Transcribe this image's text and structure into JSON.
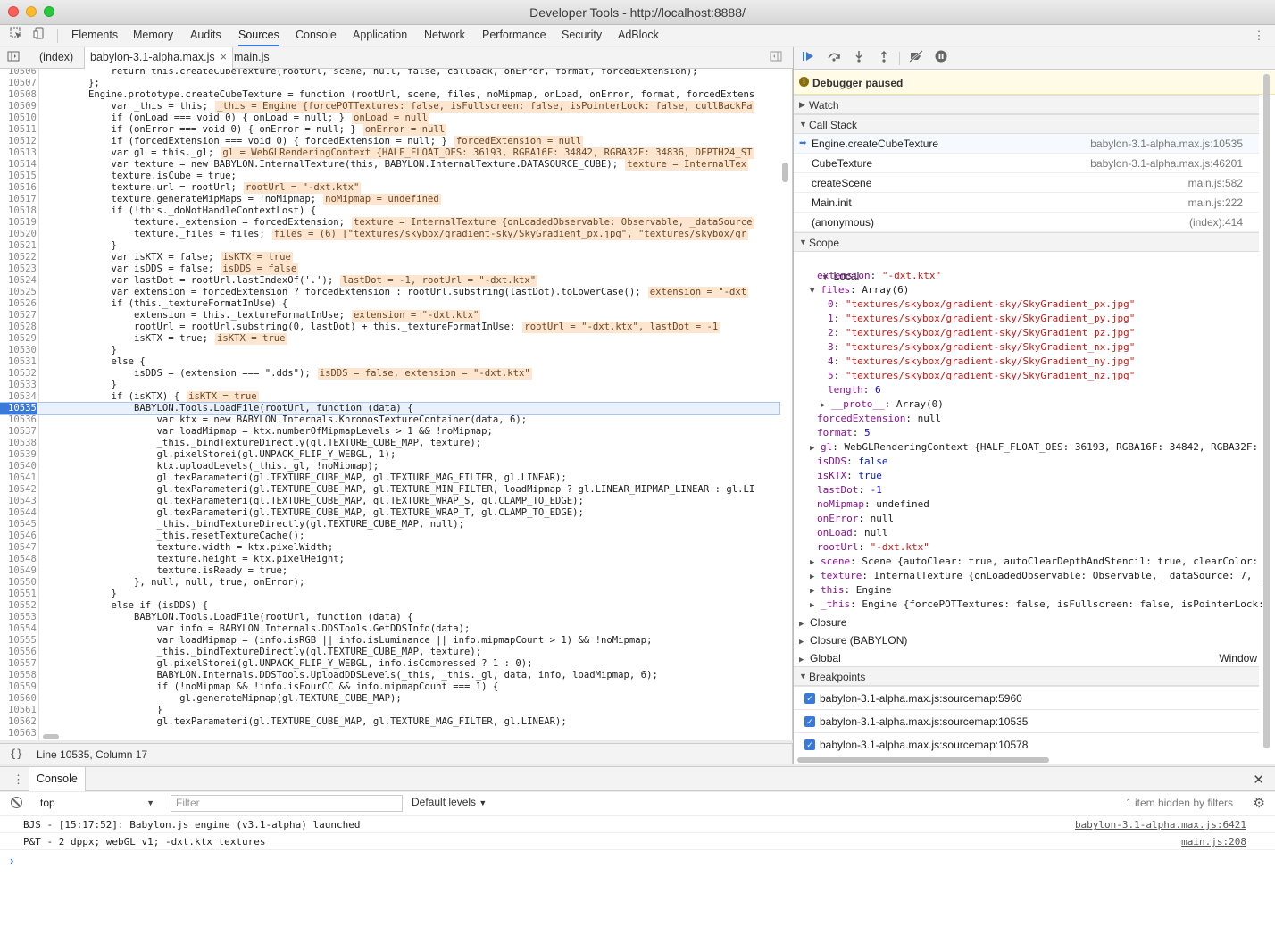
{
  "window": {
    "title": "Developer Tools - http://localhost:8888/"
  },
  "main_tabs": [
    "Elements",
    "Memory",
    "Audits",
    "Sources",
    "Console",
    "Application",
    "Network",
    "Performance",
    "Security",
    "AdBlock"
  ],
  "active_main_tab": "Sources",
  "file_tabs": [
    {
      "label": "(index)"
    },
    {
      "label": "babylon-3.1-alpha.max.js",
      "close": "×"
    },
    {
      "label": "main.js"
    }
  ],
  "code_lines": [
    [
      "10506",
      "            return this.createCubeTexture(rootUrl, scene, null, false, callback, onError, format, forcedExtension);",
      ""
    ],
    [
      "10507",
      "        };",
      ""
    ],
    [
      "10508",
      "        Engine.prototype.createCubeTexture = function (rootUrl, scene, files, noMipmap, onLoad, onError, format, forcedExtens",
      ""
    ],
    [
      "10509",
      "            var _this = this;",
      "_this = Engine {forcePOTTextures: false, isFullscreen: false, isPointerLock: false, cullBackFa"
    ],
    [
      "10510",
      "            if (onLoad === void 0) { onLoad = null; }",
      "onLoad = null"
    ],
    [
      "10511",
      "            if (onError === void 0) { onError = null; }",
      "onError = null"
    ],
    [
      "10512",
      "            if (forcedExtension === void 0) { forcedExtension = null; }",
      "forcedExtension = null"
    ],
    [
      "10513",
      "            var gl = this._gl;",
      "gl = WebGLRenderingContext {HALF_FLOAT_OES: 36193, RGBA16F: 34842, RGBA32F: 34836, DEPTH24_ST"
    ],
    [
      "10514",
      "            var texture = new BABYLON.InternalTexture(this, BABYLON.InternalTexture.DATASOURCE_CUBE);",
      "texture = InternalTex"
    ],
    [
      "10515",
      "            texture.isCube = true;",
      ""
    ],
    [
      "10516",
      "            texture.url = rootUrl;",
      "rootUrl = \"-dxt.ktx\""
    ],
    [
      "10517",
      "            texture.generateMipMaps = !noMipmap;",
      "noMipmap = undefined"
    ],
    [
      "10518",
      "            if (!this._doNotHandleContextLost) {",
      ""
    ],
    [
      "10519",
      "                texture._extension = forcedExtension;",
      "texture = InternalTexture {onLoadedObservable: Observable, _dataSource"
    ],
    [
      "10520",
      "                texture._files = files;",
      "files = (6) [\"textures/skybox/gradient-sky/SkyGradient_px.jpg\", \"textures/skybox/gr"
    ],
    [
      "10521",
      "            }",
      ""
    ],
    [
      "10522",
      "            var isKTX = false;",
      "isKTX = true"
    ],
    [
      "10523",
      "            var isDDS = false;",
      "isDDS = false"
    ],
    [
      "10524",
      "            var lastDot = rootUrl.lastIndexOf('.');",
      "lastDot = -1, rootUrl = \"-dxt.ktx\""
    ],
    [
      "10525",
      "            var extension = forcedExtension ? forcedExtension : rootUrl.substring(lastDot).toLowerCase();",
      "extension = \"-dxt"
    ],
    [
      "10526",
      "            if (this._textureFormatInUse) {",
      ""
    ],
    [
      "10527",
      "                extension = this._textureFormatInUse;",
      "extension = \"-dxt.ktx\""
    ],
    [
      "10528",
      "                rootUrl = rootUrl.substring(0, lastDot) + this._textureFormatInUse;",
      "rootUrl = \"-dxt.ktx\", lastDot = -1"
    ],
    [
      "10529",
      "                isKTX = true;",
      "isKTX = true"
    ],
    [
      "10530",
      "            }",
      ""
    ],
    [
      "10531",
      "            else {",
      ""
    ],
    [
      "10532",
      "                isDDS = (extension === \".dds\");",
      "isDDS = false, extension = \"-dxt.ktx\""
    ],
    [
      "10533",
      "            }",
      ""
    ],
    [
      "10534",
      "            if (isKTX) {",
      "isKTX = true"
    ],
    [
      "10535",
      "                BABYLON.Tools.LoadFile(rootUrl, function (data) {",
      ""
    ],
    [
      "10536",
      "                    var ktx = new BABYLON.Internals.KhronosTextureContainer(data, 6);",
      ""
    ],
    [
      "10537",
      "                    var loadMipmap = ktx.numberOfMipmapLevels > 1 && !noMipmap;",
      ""
    ],
    [
      "10538",
      "                    _this._bindTextureDirectly(gl.TEXTURE_CUBE_MAP, texture);",
      ""
    ],
    [
      "10539",
      "                    gl.pixelStorei(gl.UNPACK_FLIP_Y_WEBGL, 1);",
      ""
    ],
    [
      "10540",
      "                    ktx.uploadLevels(_this._gl, !noMipmap);",
      ""
    ],
    [
      "10541",
      "                    gl.texParameteri(gl.TEXTURE_CUBE_MAP, gl.TEXTURE_MAG_FILTER, gl.LINEAR);",
      ""
    ],
    [
      "10542",
      "                    gl.texParameteri(gl.TEXTURE_CUBE_MAP, gl.TEXTURE_MIN_FILTER, loadMipmap ? gl.LINEAR_MIPMAP_LINEAR : gl.LI",
      ""
    ],
    [
      "10543",
      "                    gl.texParameteri(gl.TEXTURE_CUBE_MAP, gl.TEXTURE_WRAP_S, gl.CLAMP_TO_EDGE);",
      ""
    ],
    [
      "10544",
      "                    gl.texParameteri(gl.TEXTURE_CUBE_MAP, gl.TEXTURE_WRAP_T, gl.CLAMP_TO_EDGE);",
      ""
    ],
    [
      "10545",
      "                    _this._bindTextureDirectly(gl.TEXTURE_CUBE_MAP, null);",
      ""
    ],
    [
      "10546",
      "                    _this.resetTextureCache();",
      ""
    ],
    [
      "10547",
      "                    texture.width = ktx.pixelWidth;",
      ""
    ],
    [
      "10548",
      "                    texture.height = ktx.pixelHeight;",
      ""
    ],
    [
      "10549",
      "                    texture.isReady = true;",
      ""
    ],
    [
      "10550",
      "                }, null, null, true, onError);",
      ""
    ],
    [
      "10551",
      "            }",
      ""
    ],
    [
      "10552",
      "            else if (isDDS) {",
      ""
    ],
    [
      "10553",
      "                BABYLON.Tools.LoadFile(rootUrl, function (data) {",
      ""
    ],
    [
      "10554",
      "                    var info = BABYLON.Internals.DDSTools.GetDDSInfo(data);",
      ""
    ],
    [
      "10555",
      "                    var loadMipmap = (info.isRGB || info.isLuminance || info.mipmapCount > 1) && !noMipmap;",
      ""
    ],
    [
      "10556",
      "                    _this._bindTextureDirectly(gl.TEXTURE_CUBE_MAP, texture);",
      ""
    ],
    [
      "10557",
      "                    gl.pixelStorei(gl.UNPACK_FLIP_Y_WEBGL, info.isCompressed ? 1 : 0);",
      ""
    ],
    [
      "10558",
      "                    BABYLON.Internals.DDSTools.UploadDDSLevels(_this, _this._gl, data, info, loadMipmap, 6);",
      ""
    ],
    [
      "10559",
      "                    if (!noMipmap && !info.isFourCC && info.mipmapCount === 1) {",
      ""
    ],
    [
      "10560",
      "                        gl.generateMipmap(gl.TEXTURE_CUBE_MAP);",
      ""
    ],
    [
      "10561",
      "                    }",
      ""
    ],
    [
      "10562",
      "                    gl.texParameteri(gl.TEXTURE_CUBE_MAP, gl.TEXTURE_MAG_FILTER, gl.LINEAR);",
      ""
    ],
    [
      "10563",
      "",
      ""
    ]
  ],
  "editor_status": {
    "braces": "{}",
    "position": "Line 10535, Column 17"
  },
  "debugger": {
    "paused_text": "Debugger paused",
    "sections": {
      "watch": "Watch",
      "call_stack": "Call Stack",
      "scope": "Scope",
      "breakpoints": "Breakpoints"
    },
    "call_stack": [
      {
        "name": "Engine.createCubeTexture",
        "loc": "babylon-3.1-alpha.max.js:10535"
      },
      {
        "name": "CubeTexture",
        "loc": "babylon-3.1-alpha.max.js:46201"
      },
      {
        "name": "createScene",
        "loc": "main.js:582"
      },
      {
        "name": "Main.init",
        "loc": "main.js:222"
      },
      {
        "name": "(anonymous)",
        "loc": "(index):414"
      }
    ],
    "scope_local_label": "Local",
    "scope_lines": [
      [
        "",
        "extension",
        ": ",
        "\"-dxt.ktx\"",
        "str"
      ],
      [
        "▼",
        "files",
        ": ",
        "Array(6)",
        "plain"
      ],
      [
        "",
        "0",
        ": ",
        "\"textures/skybox/gradient-sky/SkyGradient_px.jpg\"",
        "str"
      ],
      [
        "",
        "1",
        ": ",
        "\"textures/skybox/gradient-sky/SkyGradient_py.jpg\"",
        "str"
      ],
      [
        "",
        "2",
        ": ",
        "\"textures/skybox/gradient-sky/SkyGradient_pz.jpg\"",
        "str"
      ],
      [
        "",
        "3",
        ": ",
        "\"textures/skybox/gradient-sky/SkyGradient_nx.jpg\"",
        "str"
      ],
      [
        "",
        "4",
        ": ",
        "\"textures/skybox/gradient-sky/SkyGradient_ny.jpg\"",
        "str"
      ],
      [
        "",
        "5",
        ": ",
        "\"textures/skybox/gradient-sky/SkyGradient_nz.jpg\"",
        "str"
      ],
      [
        "",
        "length",
        ": ",
        "6",
        "num"
      ],
      [
        "▶",
        "__proto__",
        ": ",
        "Array(0)",
        "plain"
      ],
      [
        "",
        "forcedExtension",
        ": ",
        "null",
        "plain"
      ],
      [
        "",
        "format",
        ": ",
        "5",
        "num"
      ],
      [
        "▶",
        "gl",
        ": ",
        "WebGLRenderingContext {HALF_FLOAT_OES: 36193, RGBA16F: 34842, RGBA32F:",
        "plain"
      ],
      [
        "",
        "isDDS",
        ": ",
        "false",
        "kw"
      ],
      [
        "",
        "isKTX",
        ": ",
        "true",
        "kw"
      ],
      [
        "",
        "lastDot",
        ": ",
        "-1",
        "num"
      ],
      [
        "",
        "noMipmap",
        ": ",
        "undefined",
        "plain"
      ],
      [
        "",
        "onError",
        ": ",
        "null",
        "plain"
      ],
      [
        "",
        "onLoad",
        ": ",
        "null",
        "plain"
      ],
      [
        "",
        "rootUrl",
        ": ",
        "\"-dxt.ktx\"",
        "str"
      ],
      [
        "▶",
        "scene",
        ": ",
        "Scene {autoClear: true, autoClearDepthAndStencil: true, clearColor:",
        "plain"
      ],
      [
        "▶",
        "texture",
        ": ",
        "InternalTexture {onLoadedObservable: Observable, _dataSource: 7, _",
        "plain"
      ],
      [
        "▶",
        "this",
        ": ",
        "Engine",
        "plain"
      ],
      [
        "▶",
        "_this",
        ": ",
        "Engine {forcePOTTextures: false, isFullscreen: false, isPointerLock:",
        "plain"
      ]
    ],
    "closures": [
      {
        "label": "Closure",
        "value": ""
      },
      {
        "label": "Closure (BABYLON)",
        "value": ""
      },
      {
        "label": "Global",
        "value": "Window"
      }
    ],
    "breakpoints": [
      "babylon-3.1-alpha.max.js:sourcemap:5960",
      "babylon-3.1-alpha.max.js:sourcemap:10535",
      "babylon-3.1-alpha.max.js:sourcemap:10578"
    ]
  },
  "console": {
    "tab_label": "Console",
    "context": "top",
    "filter_placeholder": "Filter",
    "levels": "Default levels",
    "hidden_note": "1 item hidden by filters",
    "messages": [
      {
        "text": "BJS - [15:17:52]: Babylon.js engine (v3.1-alpha) launched",
        "source": "babylon-3.1-alpha.max.js:6421"
      },
      {
        "text": "P&T - 2 dppx; webGL v1; -dxt.ktx textures",
        "source": "main.js:208"
      }
    ],
    "prompt": "›"
  }
}
